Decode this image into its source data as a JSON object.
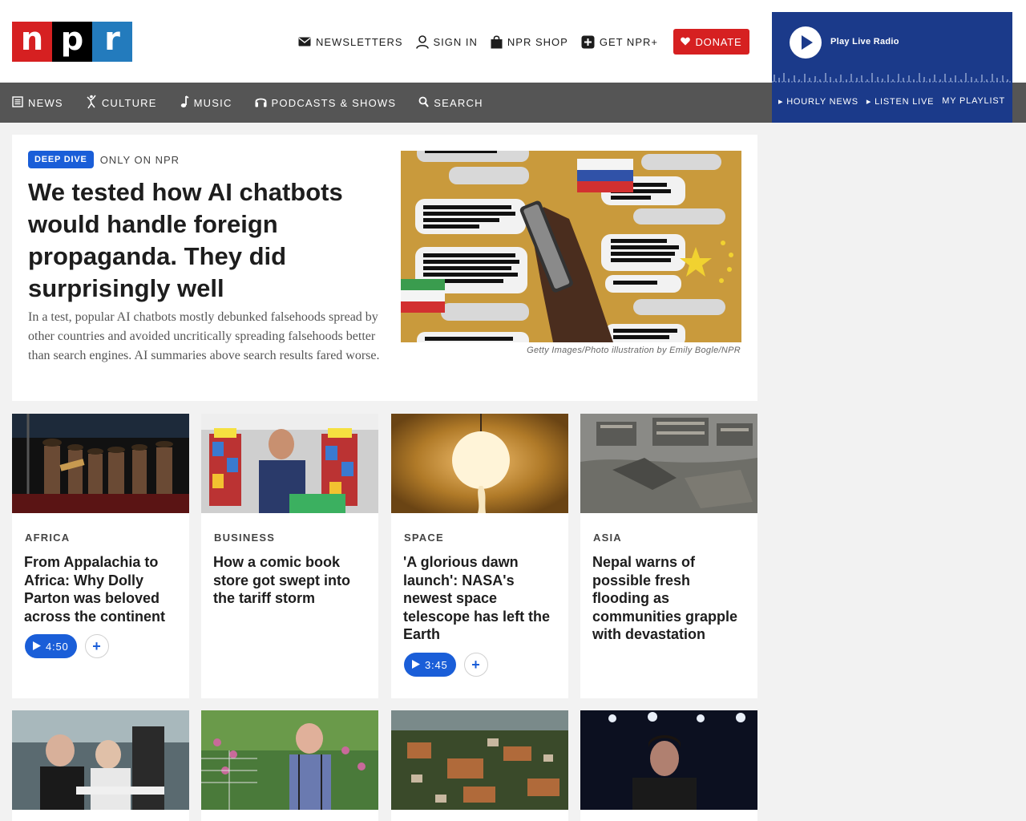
{
  "brand": {
    "logo_letters": [
      "n",
      "p",
      "r"
    ],
    "colors": {
      "n": "#d62021",
      "p": "#000000",
      "r": "#237bbd"
    }
  },
  "utility_nav": [
    {
      "label": "NEWSLETTERS",
      "icon": "envelope-icon"
    },
    {
      "label": "SIGN IN",
      "icon": "user-icon"
    },
    {
      "label": "NPR SHOP",
      "icon": "shopping-bag-icon"
    },
    {
      "label": "GET NPR+",
      "icon": "plus-square-icon"
    }
  ],
  "donate": {
    "label": "DONATE",
    "icon": "heart-icon",
    "color": "#d62021"
  },
  "main_nav": [
    {
      "label": "NEWS",
      "icon": "newspaper-icon"
    },
    {
      "label": "CULTURE",
      "icon": "dancer-icon"
    },
    {
      "label": "MUSIC",
      "icon": "music-note-icon"
    },
    {
      "label": "PODCASTS & SHOWS",
      "icon": "headphones-icon"
    },
    {
      "label": "SEARCH",
      "icon": "search-icon"
    }
  ],
  "player": {
    "label": "Play Live Radio",
    "links": [
      "HOURLY NEWS",
      "LISTEN LIVE",
      "MY PLAYLIST"
    ],
    "background": "#1b3a8a"
  },
  "hero": {
    "badge": "DEEP DIVE",
    "tag": "ONLY ON NPR",
    "title": "We tested how AI chatbots would handle foreign propaganda. They did surprisingly well",
    "teaser": "In a test, popular AI chatbots mostly debunked falsehoods spread by other countries and avoided uncritically spreading falsehoods better than search engines. AI summaries above search results fared worse.",
    "credit": "Getty Images/Photo illustration by Emily Bogle/NPR"
  },
  "stories": [
    {
      "slug": "AFRICA",
      "title": "From Appalachia to Africa: Why Dolly Parton was beloved across the continent",
      "audio": "4:50"
    },
    {
      "slug": "BUSINESS",
      "title": "How a comic book store got swept into the tariff storm"
    },
    {
      "slug": "SPACE",
      "title": "'A glorious dawn launch': NASA's newest space telescope has left the Earth",
      "audio": "3:45"
    },
    {
      "slug": "ASIA",
      "title": "Nepal warns of possible fresh flooding as communities grapple with devastation"
    }
  ],
  "accent_color": "#1a5ed8"
}
